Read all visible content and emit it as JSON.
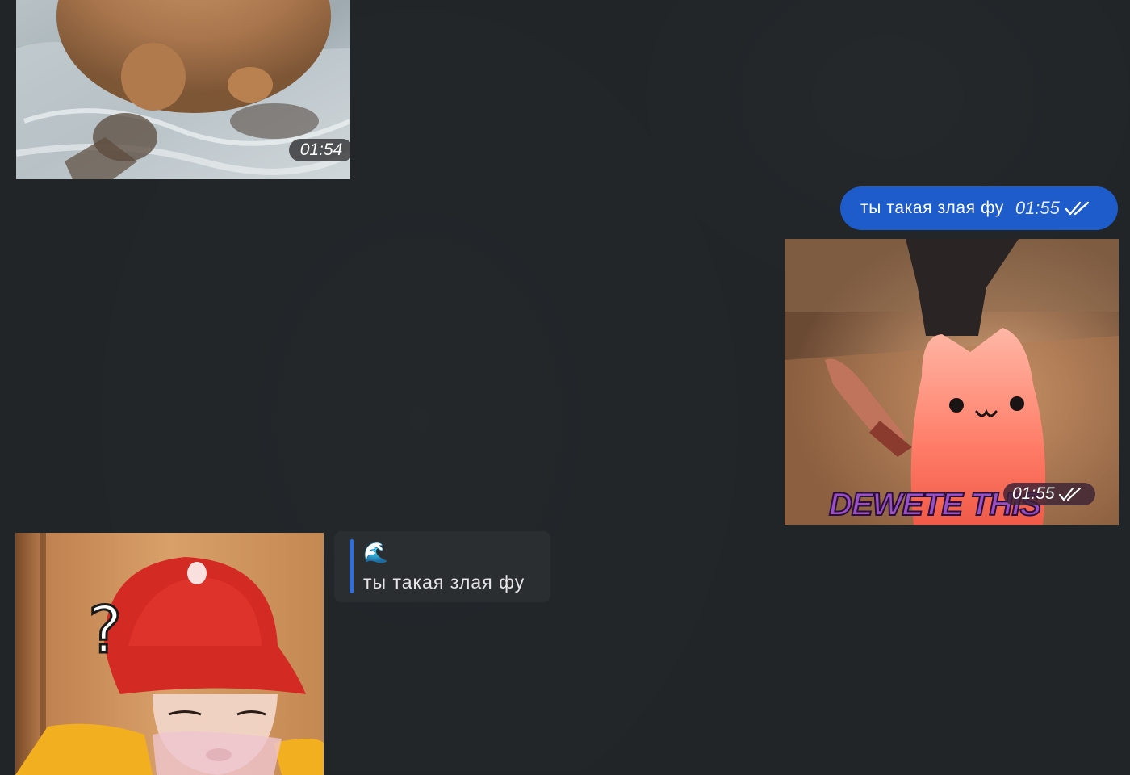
{
  "messages": [
    {
      "id": "capybara",
      "kind": "image",
      "direction": "incoming",
      "subject": "capybara standing in shallow water",
      "time": "01:54"
    },
    {
      "id": "outgoing-text",
      "kind": "text",
      "direction": "outgoing",
      "text": "ты такая злая фу",
      "time": "01:55",
      "status_icon": "double-check-icon"
    },
    {
      "id": "cat-knife",
      "kind": "gif",
      "direction": "outgoing",
      "subject": "pink cat holding a knife",
      "caption": "DEWETE THIS",
      "time": "01:55",
      "status_icon": "double-check-icon"
    },
    {
      "id": "hat-man",
      "kind": "image",
      "direction": "incoming",
      "subject": "person wearing a red bucket hat with a question mark",
      "overlay_text": "?"
    },
    {
      "id": "reply-card",
      "kind": "reply",
      "direction": "incoming",
      "quoted_emoji": "🌊",
      "quoted_text": "ты такая злая фу"
    }
  ],
  "colors": {
    "background": "#212528",
    "outgoing_bubble": "#1e5ccc",
    "reply_bar": "#2d6fe0",
    "reply_card": "#2b2e31"
  }
}
